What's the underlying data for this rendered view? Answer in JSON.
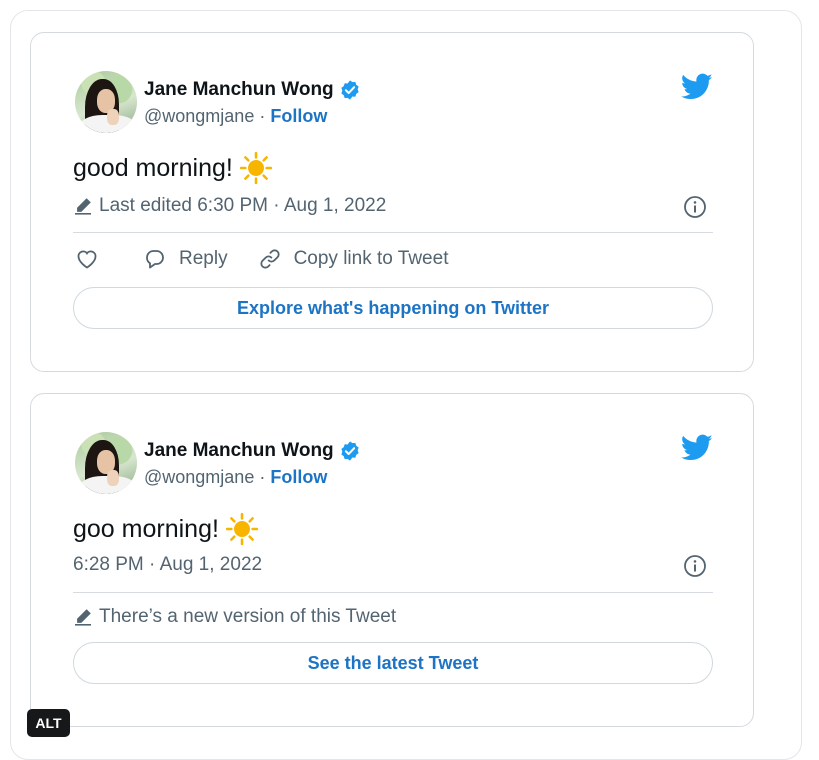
{
  "tweets": [
    {
      "author_name": "Jane Manchun Wong",
      "handle": "@wongmjane",
      "separator": " · ",
      "follow_label": "Follow",
      "text": "good morning!",
      "meta": "Last edited 6:30 PM · Aug 1, 2022",
      "actions": {
        "reply": "Reply",
        "copy_link": "Copy link to Tweet"
      },
      "cta": "Explore what's happening on Twitter"
    },
    {
      "author_name": "Jane Manchun Wong",
      "handle": "@wongmjane",
      "separator": " · ",
      "follow_label": "Follow",
      "text": "goo morning!",
      "meta": "6:28 PM · Aug 1, 2022",
      "notice": "There’s a new version of this Tweet",
      "cta": "See the latest Tweet"
    }
  ],
  "alt_badge": "ALT",
  "colors": {
    "link": "#1d74c5",
    "twitter_blue": "#1d9bf0",
    "muted": "#536471",
    "sun": "#f7b500"
  },
  "icons": [
    "verified-badge-icon",
    "twitter-bird-icon",
    "sun-emoji-icon",
    "pencil-icon",
    "info-icon",
    "heart-icon",
    "reply-bubble-icon",
    "link-icon"
  ]
}
